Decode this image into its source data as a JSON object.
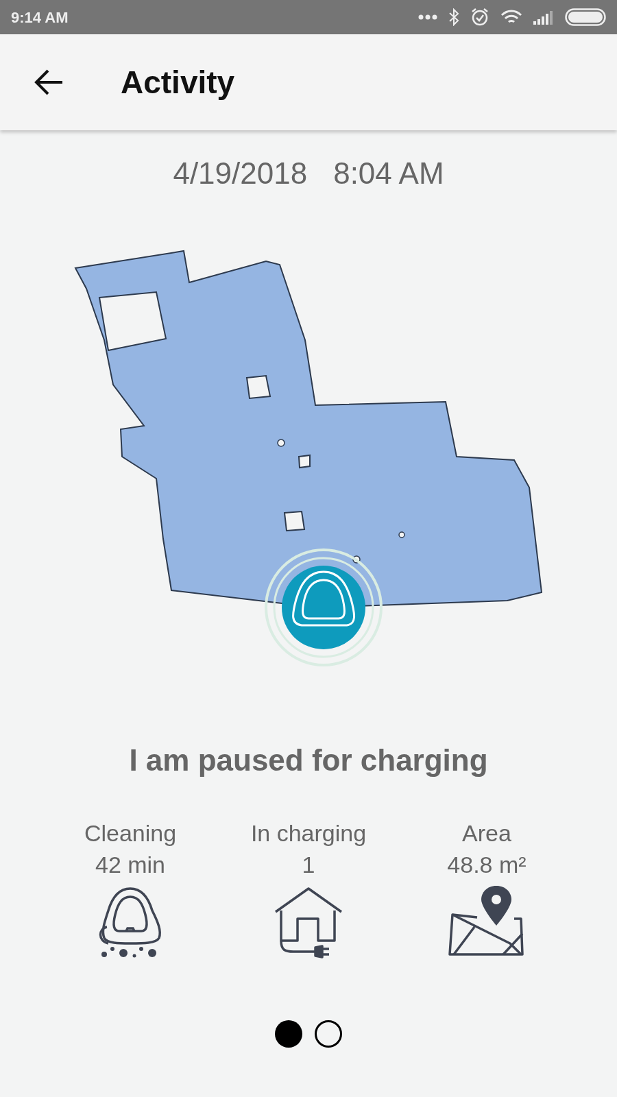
{
  "status_bar": {
    "time": "9:14 AM"
  },
  "app_bar": {
    "title": "Activity"
  },
  "session": {
    "date": "4/19/2018",
    "time": "8:04 AM"
  },
  "status_message": "I am paused for charging",
  "stats": [
    {
      "kind": "robot",
      "label": "Cleaning",
      "value": "42 min"
    },
    {
      "kind": "dock",
      "label": "In charging",
      "value": "1"
    },
    {
      "kind": "area",
      "label": "Area",
      "value": "48.8 m²"
    }
  ],
  "pages": [
    {
      "selected": true
    },
    {
      "selected": false
    }
  ]
}
